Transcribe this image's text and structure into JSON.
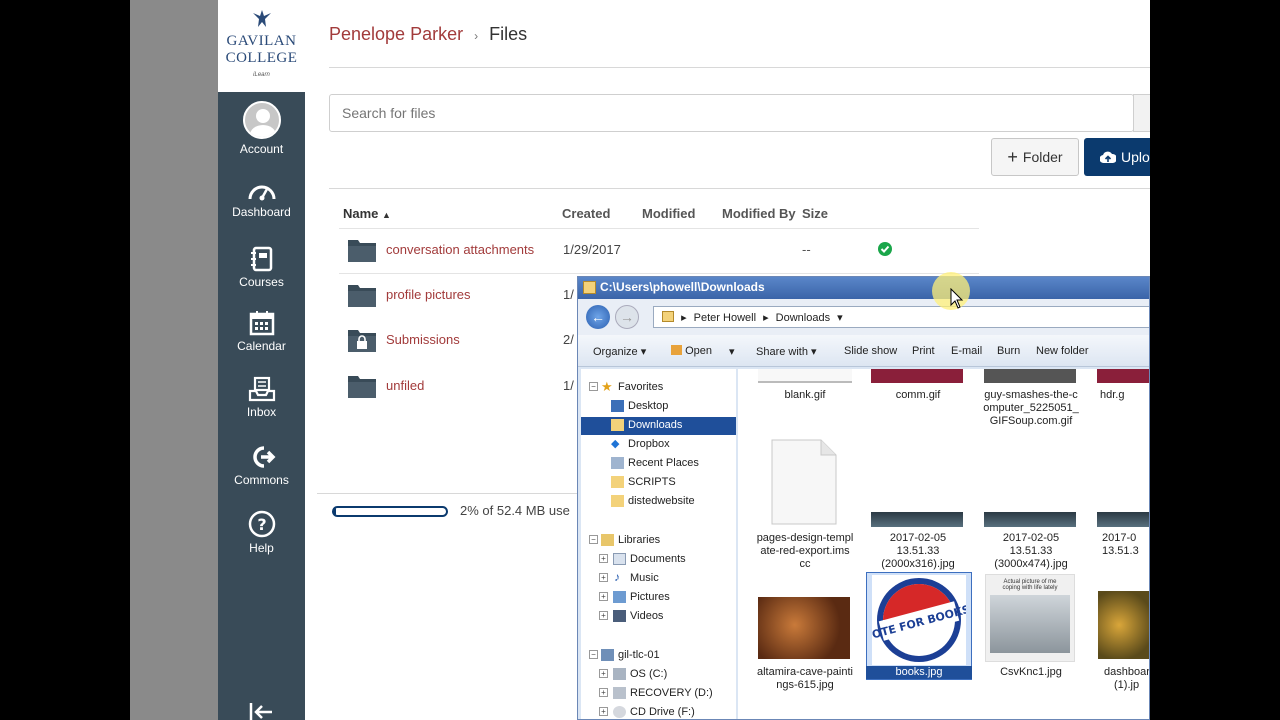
{
  "colors": {
    "nav_bg": "#394b58",
    "brand_red": "#a23b3b",
    "primary_blue": "#0b3a6e",
    "success": "#1aa64a",
    "explorer_selected": "#1f4f9a"
  },
  "logo": {
    "line1": "GAVILAN",
    "line2": "COLLEGE",
    "sub": "iLearn"
  },
  "global_nav": {
    "account": "Account",
    "dashboard": "Dashboard",
    "courses": "Courses",
    "calendar": "Calendar",
    "inbox": "Inbox",
    "commons": "Commons",
    "help": "Help"
  },
  "breadcrumb": {
    "user": "Penelope Parker",
    "current": "Files"
  },
  "search": {
    "placeholder": "Search for files"
  },
  "buttons": {
    "folder": "Folder",
    "upload": "Uplo"
  },
  "table": {
    "headers": {
      "name": "Name",
      "created": "Created",
      "modified": "Modified",
      "modified_by": "Modified By",
      "size": "Size"
    },
    "rows": [
      {
        "name": "conversation attachments",
        "created": "1/29/2017",
        "size": "--",
        "icon": "folder-icon"
      },
      {
        "name": "profile pictures",
        "created": "1/",
        "icon": "folder-icon"
      },
      {
        "name": "Submissions",
        "created": "2/",
        "icon": "locked-folder-icon"
      },
      {
        "name": "unfiled",
        "created": "1/",
        "icon": "folder-icon"
      }
    ]
  },
  "quota": {
    "text": "2% of 52.4 MB use",
    "fraction": 0.02
  },
  "explorer": {
    "title": "C:\\Users\\phowell\\Downloads",
    "address": {
      "root": "Peter Howell",
      "current": "Downloads"
    },
    "toolbar": {
      "organize": "Organize",
      "open": "Open",
      "share_with": "Share with",
      "slide_show": "Slide show",
      "print": "Print",
      "email": "E-mail",
      "burn": "Burn",
      "new_folder": "New folder"
    },
    "nav": {
      "favorites": "Favorites",
      "desktop": "Desktop",
      "downloads": "Downloads",
      "dropbox": "Dropbox",
      "recent_places": "Recent Places",
      "scripts": "SCRIPTS",
      "distedwebsite": "distedwebsite",
      "libraries": "Libraries",
      "documents": "Documents",
      "music": "Music",
      "pictures": "Pictures",
      "videos": "Videos",
      "computer": "gil-tlc-01",
      "os": "OS (C:)",
      "recovery": "RECOVERY (D:)",
      "cd": "CD Drive (F:)"
    },
    "files": {
      "f1": "blank.gif",
      "f2": "comm.gif",
      "f3a": "guy-smashes-the-c",
      "f3b": "omputer_5225051_",
      "f3c": "GIFSoup.com.gif",
      "f4": "hdr.g",
      "f5a": "pages-design-templ",
      "f5b": "ate-red-export.ims",
      "f5c": "cc",
      "f6a": "2017-02-05",
      "f6b": "13.51.33",
      "f6c": "(2000x316).jpg",
      "f7a": "2017-02-05",
      "f7b": "13.51.33",
      "f7c": "(3000x474).jpg",
      "f8a": "2017-0",
      "f8b": "13.51.3",
      "f9a": "altamira-cave-painti",
      "f9b": "ngs-615.jpg",
      "f10": "books.jpg",
      "f11": "CsvKnc1.jpg",
      "f12a": "dashboar",
      "f12b": "(1).jp",
      "vote_text": "VOTE FOR BOOKS!",
      "csv_caption_a": "Actual picture of me",
      "csv_caption_b": "coping with life lately"
    }
  }
}
